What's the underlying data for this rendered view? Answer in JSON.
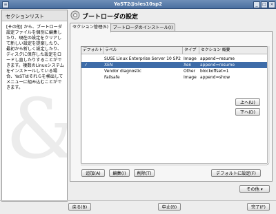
{
  "window": {
    "title": "YaST2@sles10sp2"
  },
  "sidebar": {
    "title": "セクションリスト",
    "help": "[その他] から、ブートローダ設定ファイルを個別に編集したり、現在の設定をクリアして新しい設定を提案したり、最初から新しく設定したり、ディスクに保存した設定をロードし直したりすることができます。複数のLinuxシステムをインストールしている場合、YaSTはそれらを検出してメニューに組み込むことができます。"
  },
  "page": {
    "title": "ブートローダの設定"
  },
  "tabs": [
    {
      "label": "セクション管理(S)"
    },
    {
      "label": "ブートローダのインストール(I)"
    }
  ],
  "table": {
    "columns": [
      "デフォルト",
      "ラベル",
      "タイプ",
      "セクション 概要"
    ],
    "rows": [
      {
        "default": "",
        "label": "SUSE Linux Enterprise Server 10 SP2",
        "type": "Image",
        "summary": "append=resume"
      },
      {
        "default": "✓",
        "label": "XEN",
        "type": "Xen",
        "summary": "append=resume"
      },
      {
        "default": "",
        "label": "Vendor diagnostic",
        "type": "Other",
        "summary": "blockoffset=1"
      },
      {
        "default": "",
        "label": "Failsafe",
        "type": "Image",
        "summary": "append=show"
      }
    ]
  },
  "buttons": {
    "up": "上へ(U)",
    "down": "下へ(D)",
    "add": "追加(A)",
    "edit": "編集(I)",
    "delete": "削除(T)",
    "set_default": "デフォルトに設定(F)",
    "other": "その他 ▾",
    "back": "戻る(B)",
    "abort": "中止(B)",
    "finish": "完了(F)"
  },
  "colors": {
    "selection": "#3e6ca8",
    "titlebar": "#5a7eae"
  }
}
